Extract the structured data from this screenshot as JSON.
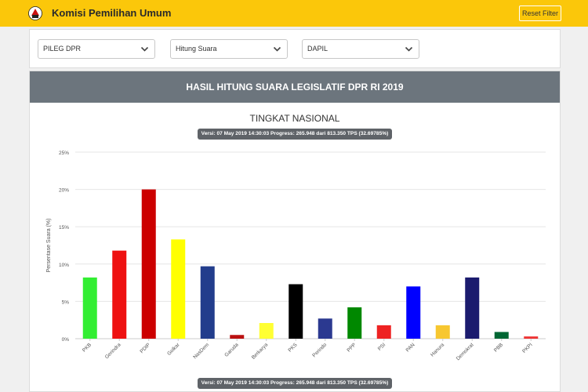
{
  "header": {
    "brand": "Komisi Pemilihan Umum",
    "reset_label": "Reset Filter",
    "logo_icon": "kpu-logo-icon"
  },
  "filters": {
    "election": "PILEG DPR",
    "mode": "Hitung Suara",
    "region": "DAPIL"
  },
  "panel": {
    "title": "HASIL HITUNG SUARA LEGISLATIF DPR RI 2019",
    "version_text": "Versi: 07 May 2019 14:30:03 Progress: 265.948 dari 813.350 TPS (32.69785%)"
  },
  "colors": {
    "topbar": "#fbc70a",
    "header_panel": "#6c757d"
  },
  "chart_data": {
    "type": "bar",
    "title": "TINGKAT NASIONAL",
    "xlabel": "",
    "ylabel": "Persentase Suara (%)",
    "ylim": [
      0,
      25
    ],
    "yticks": [
      "0%",
      "5%",
      "10%",
      "15%",
      "20%",
      "25%"
    ],
    "grid": true,
    "categories": [
      "PKB",
      "Gerindra",
      "PDIP",
      "Golkar",
      "NasDem",
      "Garuda",
      "Berkarya",
      "PKS",
      "Perindo",
      "PPP",
      "PSI",
      "PAN",
      "Hanura",
      "Demokrat",
      "PBB",
      "PKPI"
    ],
    "values": [
      8.2,
      11.8,
      20.0,
      13.3,
      9.7,
      0.5,
      2.1,
      7.3,
      2.7,
      4.2,
      1.8,
      7.0,
      1.8,
      8.2,
      0.9,
      0.3
    ],
    "colors": [
      "#33ee33",
      "#ee1111",
      "#cc0000",
      "#ffff00",
      "#223d8c",
      "#bb1111",
      "#ffff33",
      "#000000",
      "#2b3990",
      "#008800",
      "#ee2222",
      "#0000ff",
      "#f7c730",
      "#1b1b6e",
      "#006633",
      "#ee3333"
    ]
  }
}
